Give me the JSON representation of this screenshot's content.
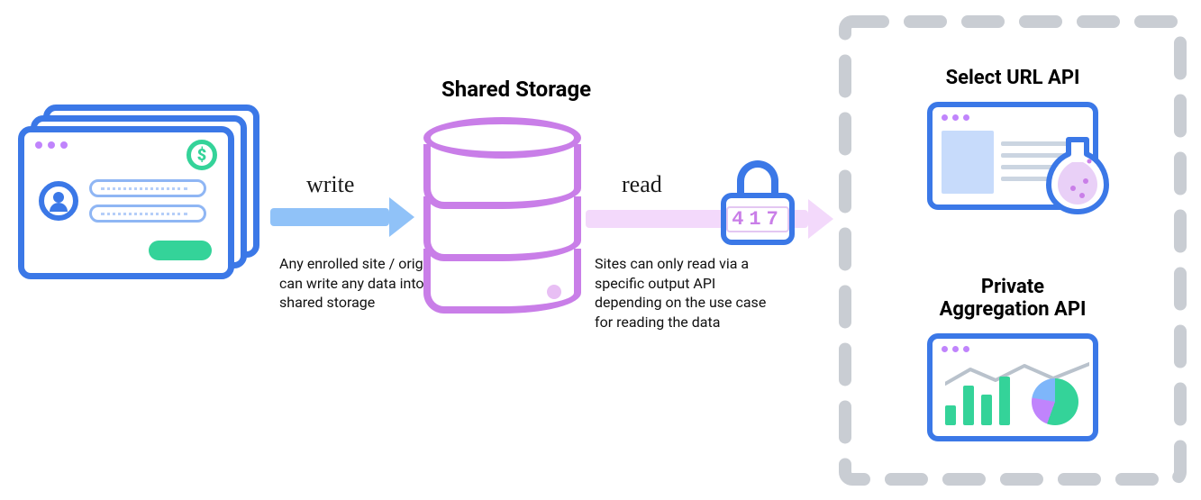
{
  "left": {
    "icon": "browser-windows-stack",
    "avatar_icon": "user-avatar-icon",
    "dollar_icon": "dollar-circle-icon"
  },
  "arrows": {
    "write": {
      "label": "write",
      "caption": "Any enrolled site / origin can write any data into shared storage"
    },
    "read": {
      "label": "read",
      "caption": "Sites can only read via a specific output API depending on the use case for reading the data",
      "lock_digits": "417"
    }
  },
  "storage": {
    "title": "Shared Storage",
    "icon": "database-cylinder-icon"
  },
  "outputs": {
    "container_icon": "dashed-box-icon",
    "apis": [
      {
        "title": "Select URL API",
        "icon": "browser-flask-icon"
      },
      {
        "title": "Private Aggregation API",
        "icon": "analytics-dashboard-icon"
      }
    ]
  },
  "colors": {
    "blue": "#3B78E7",
    "lightblue_arrow": "#90C2F8",
    "purple": "#C97EE8",
    "lilac_arrow": "#F3D9FB",
    "green": "#34D399",
    "gray_dash": "#C9CDD3"
  }
}
